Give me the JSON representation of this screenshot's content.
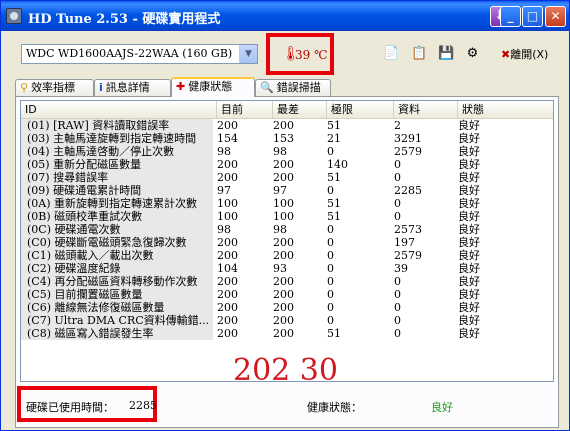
{
  "window": {
    "title": "HD Tune 2.53 - 硬碟實用程式"
  },
  "toolbar": {
    "drive": "WDC WD1600AAJS-22WAA (160 GB)",
    "temperature": "39 ℃",
    "exit_label": "離開(X)"
  },
  "tabs": [
    {
      "label": "效率指標",
      "icon": "benchmark-icon"
    },
    {
      "label": "訊息詳情",
      "icon": "info-icon"
    },
    {
      "label": "健康狀態",
      "icon": "health-cross-icon"
    },
    {
      "label": "錯誤掃描",
      "icon": "magnifier-icon"
    }
  ],
  "table": {
    "headers": [
      "ID",
      "目前",
      "最差",
      "極限",
      "資料",
      "狀態"
    ],
    "rows": [
      [
        "(01) [RAW] 資料讀取錯誤率",
        "200",
        "200",
        "51",
        "2",
        "良好"
      ],
      [
        "(03) 主軸馬達旋轉到指定轉速時間",
        "154",
        "153",
        "21",
        "3291",
        "良好"
      ],
      [
        "(04) 主軸馬達啓動／停止次數",
        "98",
        "98",
        "0",
        "2579",
        "良好"
      ],
      [
        "(05) 重新分配磁區數量",
        "200",
        "200",
        "140",
        "0",
        "良好"
      ],
      [
        "(07) 搜尋錯誤率",
        "200",
        "200",
        "51",
        "0",
        "良好"
      ],
      [
        "(09) 硬碟通電累計時間",
        "97",
        "97",
        "0",
        "2285",
        "良好"
      ],
      [
        "(0A) 重新旋轉到指定轉速累計次數",
        "100",
        "100",
        "51",
        "0",
        "良好"
      ],
      [
        "(0B) 磁頭校準重試次數",
        "100",
        "100",
        "51",
        "0",
        "良好"
      ],
      [
        "(0C) 硬碟通電次數",
        "98",
        "98",
        "0",
        "2573",
        "良好"
      ],
      [
        "(C0) 硬碟斷電磁頭緊急復歸次數",
        "200",
        "200",
        "0",
        "197",
        "良好"
      ],
      [
        "(C1) 磁頭載入／載出次數",
        "200",
        "200",
        "0",
        "2579",
        "良好"
      ],
      [
        "(C2) 硬碟溫度紀錄",
        "104",
        "93",
        "0",
        "39",
        "良好"
      ],
      [
        "(C4) 再分配磁區資料轉移動作次數",
        "200",
        "200",
        "0",
        "0",
        "良好"
      ],
      [
        "(C5) 目前攔置磁區數量",
        "200",
        "200",
        "0",
        "0",
        "良好"
      ],
      [
        "(C6) 離線無法修復磁區數量",
        "200",
        "200",
        "0",
        "0",
        "良好"
      ],
      [
        "(C7) Ultra DMA CRC資料傳輸錯...",
        "200",
        "200",
        "0",
        "0",
        "良好"
      ],
      [
        "(C8) 磁區寫入錯誤發生率",
        "200",
        "200",
        "51",
        "0",
        "良好"
      ]
    ]
  },
  "overlay_text": "202 30",
  "footer": {
    "power_on_label": "硬碟已使用時間：",
    "power_on_value": "2285",
    "health_label": "健康狀態：",
    "health_value": "良好"
  }
}
